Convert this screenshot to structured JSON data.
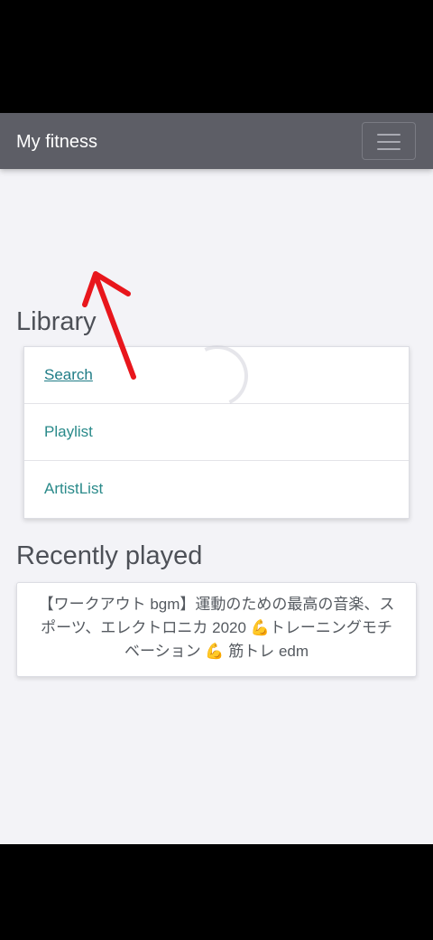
{
  "navbar": {
    "brand": "My fitness",
    "menu_icon": "hamburger-menu-icon"
  },
  "library": {
    "title": "Library",
    "items": [
      {
        "label": "Search"
      },
      {
        "label": "Playlist"
      },
      {
        "label": "ArtistList"
      }
    ]
  },
  "recent": {
    "title": "Recently played",
    "track": "【ワークアウト bgm】運動のための最高の音楽、スポーツ、エレクトロニカ 2020 💪トレーニングモチベーション 💪 筋トレ edm"
  },
  "colors": {
    "navbar_bg": "#5d5e66",
    "link": "#2a8a8a",
    "annotation_arrow": "#e8161c"
  }
}
